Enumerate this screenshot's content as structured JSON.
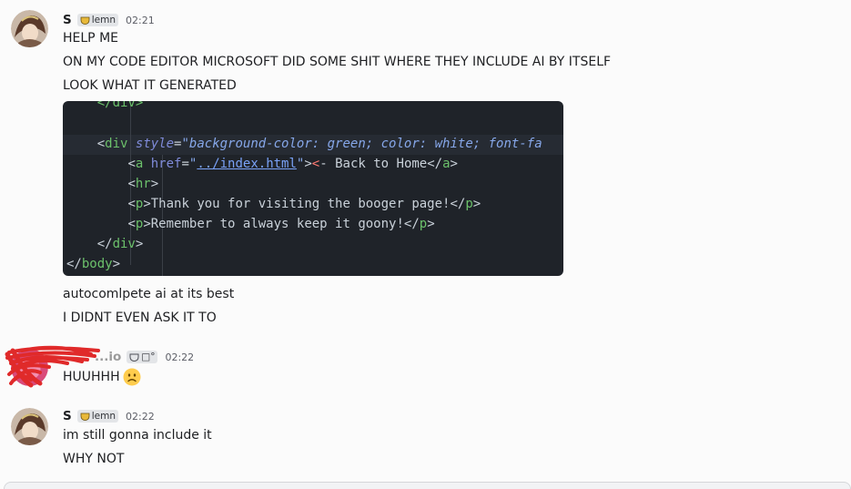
{
  "messages": [
    {
      "username": "S",
      "tag": "lemn",
      "time": "02:21",
      "lines": [
        "HELP ME",
        "ON MY CODE EDITOR MICROSOFT DID SOME SHIT WHERE THEY INCLUDE AI BY ITSELF",
        "LOOK WHAT IT GENERATED"
      ],
      "code_image": {
        "lines": [
          "    </div>",
          "",
          "    <div style=\"background-color: green; color: white; font-fa",
          "        <a href=\"../index.html\"><- Back to Home</a>",
          "        <hr>",
          "        <p>Thank you for visiting the booger page!</p>",
          "        <p>Remember to always keep it goony!</p>",
          "    </div>",
          "</body>"
        ]
      },
      "after_lines": [
        "autocomlpete ai at its best",
        "I DIDNT EVEN ASK IT TO"
      ]
    },
    {
      "username": "...io",
      "tag": "□°",
      "time": "02:22",
      "lines": [
        "HUUHHH"
      ],
      "emoji": "frowning-face"
    },
    {
      "username": "S",
      "tag": "lemn",
      "time": "02:22",
      "lines": [
        "im still gonna include it",
        "WHY NOT"
      ]
    }
  ],
  "colors": {
    "background": "#fbfbfb",
    "code_background": "#1f2329",
    "html_tag": "#6cc16b",
    "attribute": "#7f8bd9",
    "string": "#86a7e9",
    "scribble": "#e02a2a"
  }
}
